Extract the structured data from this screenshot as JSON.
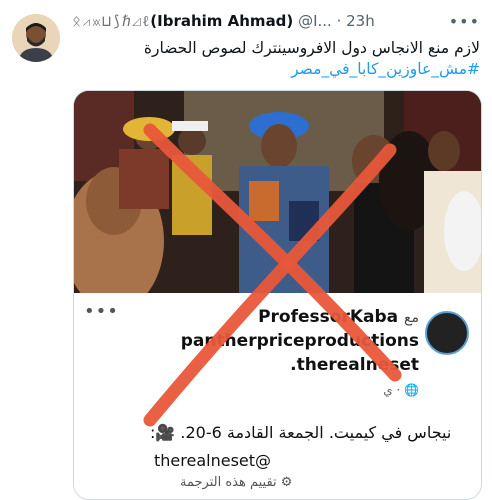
{
  "tweet": {
    "display_glyphs": "ᛟ⩘⩙⊔⟆ℏ⊿ℓ",
    "author_name": "(Ibrahim Ahmad)",
    "handle": "@I...",
    "separator": "·",
    "time": "23h",
    "more_icon": "more-dots-icon",
    "text": "لازم منع الانجاس دول الافروسينترك لصوص الحضارة",
    "hashtag": "#مش_عاوزين_كابا_في_مصر"
  },
  "embedded_card": {
    "line1_name": "ProfessorKaba",
    "line1_ma": "مع",
    "line2": "pantherpriceproductions",
    "line3": ".therealneset",
    "line4_meta": "ي · 🌐",
    "body_rtl": "نيجاس في كيميت. الجمعة القادمة 6-20. 🎥:",
    "body_handle": "therealneset@",
    "translate_label": "⚙ تقييم هذه الترجمة"
  },
  "colors": {
    "accent_link": "#1d9bf0",
    "cross": "#e8573a"
  }
}
